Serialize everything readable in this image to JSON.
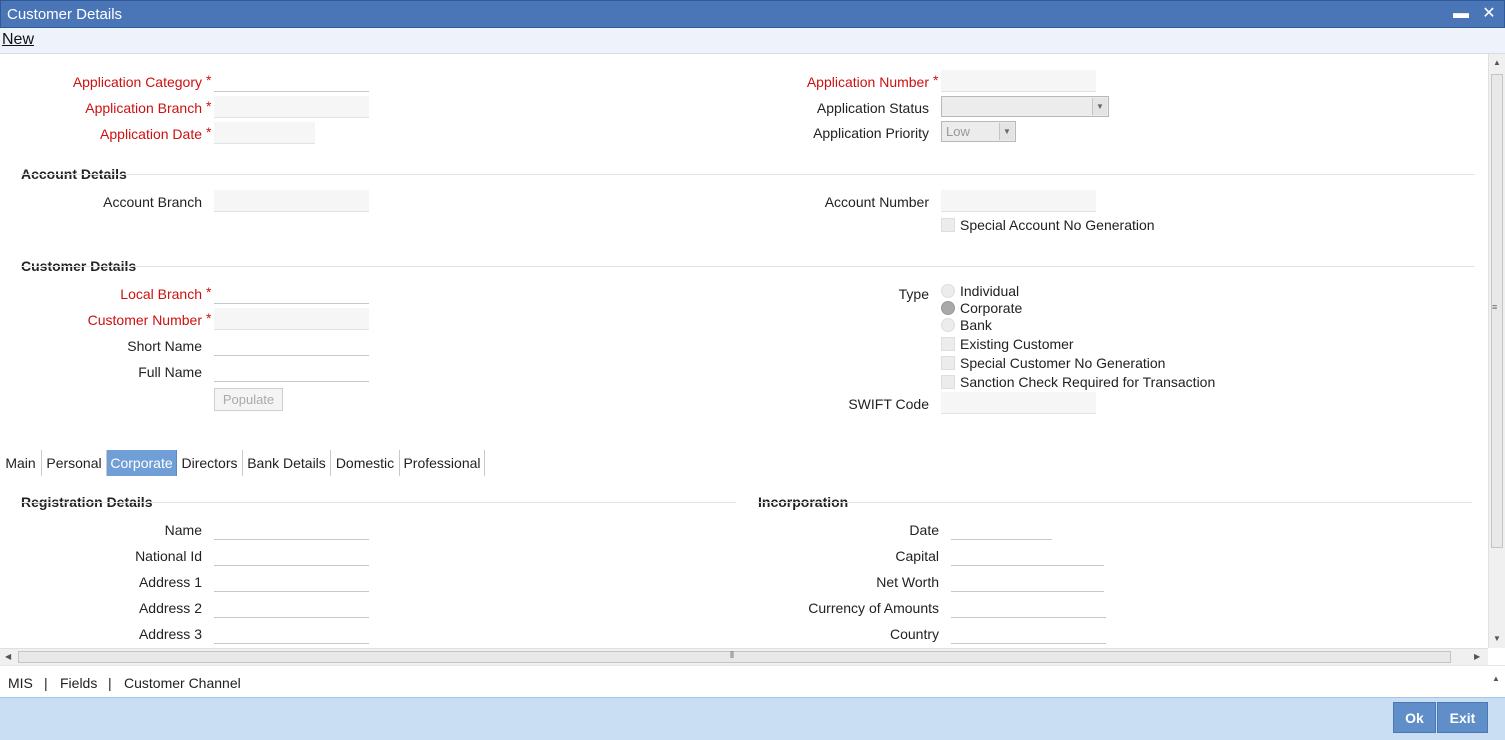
{
  "window": {
    "title": "Customer Details",
    "minimize": "▬",
    "close": "✕"
  },
  "menu": {
    "new": "New"
  },
  "application": {
    "category_label": "Application Category",
    "branch_label": "Application Branch",
    "date_label": "Application Date",
    "number_label": "Application Number",
    "status_label": "Application Status",
    "priority_label": "Application Priority",
    "priority_value": "Low",
    "required_mark": "*"
  },
  "account_details": {
    "heading": "Account Details",
    "branch_label": "Account Branch",
    "number_label": "Account Number",
    "special_no_label": "Special Account No Generation"
  },
  "customer_details": {
    "heading": "Customer Details",
    "local_branch_label": "Local Branch",
    "customer_number_label": "Customer Number",
    "short_name_label": "Short Name",
    "full_name_label": "Full Name",
    "populate_button": "Populate",
    "type_label": "Type",
    "type_options": [
      "Individual",
      "Corporate",
      "Bank"
    ],
    "type_selected": "Corporate",
    "existing_customer_label": "Existing Customer",
    "special_customer_no_label": "Special Customer No Generation",
    "sanction_check_label": "Sanction Check Required for Transaction",
    "swift_code_label": "SWIFT Code"
  },
  "tabs": [
    "Main",
    "Personal",
    "Corporate",
    "Directors",
    "Bank Details",
    "Domestic",
    "Professional"
  ],
  "active_tab": "Corporate",
  "registration": {
    "heading": "Registration Details",
    "name_label": "Name",
    "national_id_label": "National Id",
    "address1_label": "Address 1",
    "address2_label": "Address 2",
    "address3_label": "Address 3"
  },
  "incorporation": {
    "heading": "Incorporation",
    "date_label": "Date",
    "capital_label": "Capital",
    "net_worth_label": "Net Worth",
    "currency_label": "Currency of Amounts",
    "country_label": "Country"
  },
  "footer": {
    "links": [
      "MIS",
      "Fields",
      "Customer Channel"
    ],
    "separator": "|",
    "ok": "Ok",
    "exit": "Exit"
  },
  "scroll": {
    "grip": "≡",
    "hgrip": "⦀"
  }
}
